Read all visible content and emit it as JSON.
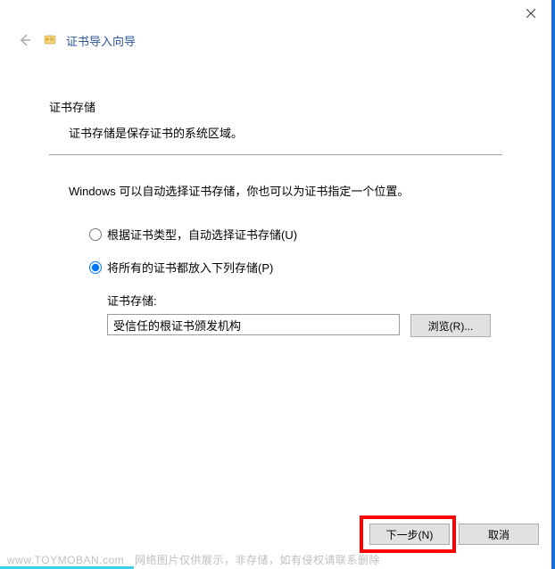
{
  "window": {
    "close_label": "×"
  },
  "header": {
    "title": "证书导入向导"
  },
  "content": {
    "section_title": "证书存储",
    "section_desc": "证书存储是保存证书的系统区域。",
    "instruction": "Windows 可以自动选择证书存储，你也可以为证书指定一个位置。",
    "radio_auto": "根据证书类型，自动选择证书存储(U)",
    "radio_manual": "将所有的证书都放入下列存储(P)",
    "store_label": "证书存储:",
    "store_value": "受信任的根证书颁发机构",
    "browse_label": "浏览(R)..."
  },
  "footer": {
    "next_label": "下一步(N)",
    "cancel_label": "取消"
  },
  "watermark": {
    "domain": "www.TOYMOBAN.com",
    "text": "网络图片仅供展示，非存储，如有侵权请联系删除"
  }
}
